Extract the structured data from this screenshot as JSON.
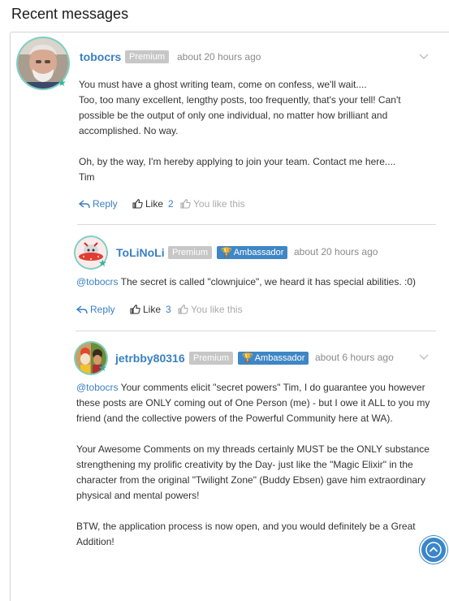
{
  "page": {
    "title": "Recent messages"
  },
  "icons": {
    "reply": "reply-arrow-icon",
    "like": "thumbs-up-icon",
    "dropdown": "chevron-down-icon",
    "trophy": "trophy-icon",
    "scroll_top": "chevron-up-circle-icon",
    "online": "star-icon"
  },
  "colors": {
    "link": "#3a7fc1",
    "premium_badge": "#c7c7c7",
    "ambassador_badge": "#3f86c5",
    "online_star": "#2fb39b"
  },
  "messages": [
    {
      "username": "tobocrs",
      "premium": "Premium",
      "time": "about 20 hours ago",
      "lines": [
        "You must have a ghost writing team, come on confess, we'll wait....",
        "Too, too many excellent, lengthy posts, too frequently, that's your tell! Can't",
        "possible be the output of only one individual, no matter how brilliant and",
        "accomplished. No way.",
        "Oh, by the way, I'm hereby applying to join your team. Contact me here....",
        "Tim"
      ],
      "reply": "Reply",
      "like": "Like",
      "like_count": "2",
      "you_like": "You like this"
    },
    {
      "username": "ToLiNoLi",
      "premium": "Premium",
      "ambassador": "Ambassador",
      "time": "about 20 hours ago",
      "mention": "@tobocrs",
      "text": " The secret is called \"clownjuice\", we heard it has special abilities. :0)",
      "reply": "Reply",
      "like": "Like",
      "like_count": "3",
      "you_like": "You like this"
    },
    {
      "username": "jetrbby80316",
      "premium": "Premium",
      "ambassador": "Ambassador",
      "time": "about 6 hours ago",
      "mention": "@tobocrs",
      "first_line_rest": " Your comments elicit \"secret powers\" Tim, I do guarantee you however",
      "lines": [
        "these posts are ONLY coming out of One Person (me) - but I owe it ALL to you my",
        "friend (and the collective powers of the Powerful Community here at WA).",
        "Your Awesome Comments on my threads certainly MUST be the ONLY substance",
        "strengthening my prolific creativity by the Day- just like the \"Magic Elixir\" in the",
        "character from the original \"Twilight Zone\" (Buddy Ebsen) gave him extraordinary",
        "physical and mental powers!",
        "BTW, the application process is now open, and you would definitely be a Great",
        "Addition!"
      ]
    }
  ]
}
